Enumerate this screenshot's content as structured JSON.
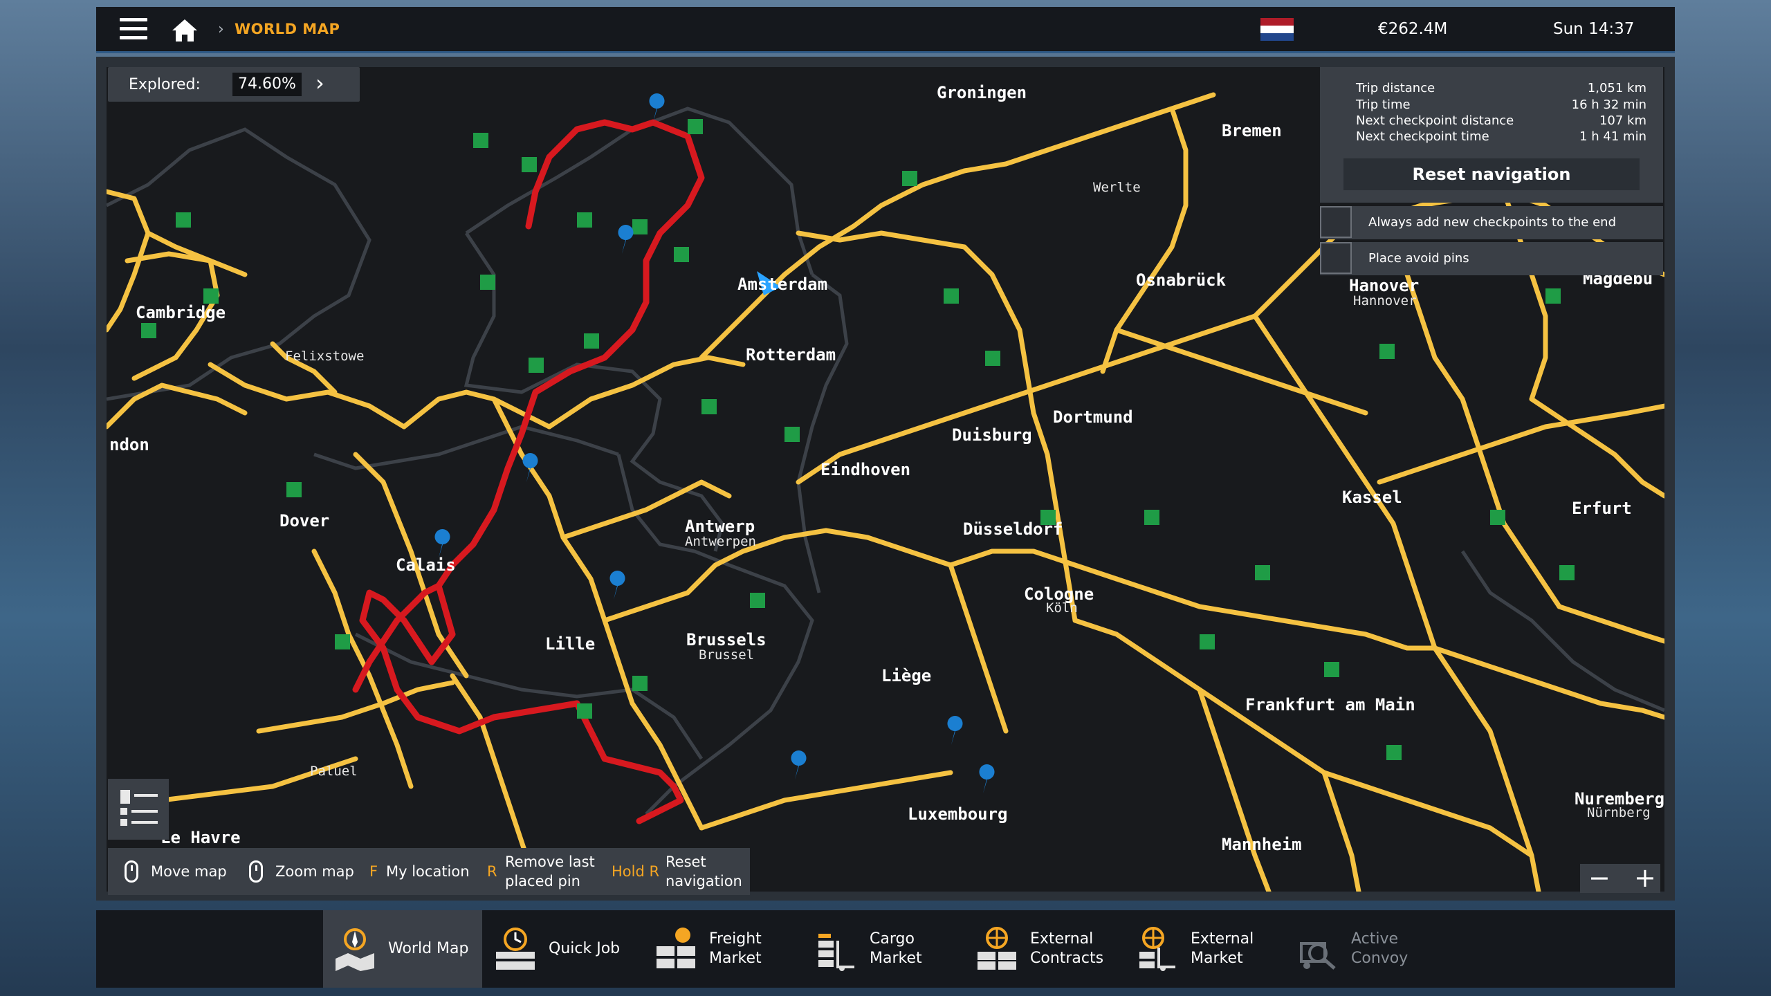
{
  "topbar": {
    "breadcrumb": "WORLD MAP",
    "money": "€262.4M",
    "clock": "Sun 14:37",
    "flag_colors": [
      "#ae1c28",
      "#ffffff",
      "#21468b"
    ]
  },
  "explored": {
    "label": "Explored:",
    "value": "74.60%"
  },
  "navigation": {
    "rows": [
      {
        "key": "Trip distance",
        "value": "1,051 km"
      },
      {
        "key": "Trip time",
        "value": "16 h 32 min"
      },
      {
        "key": "Next checkpoint distance",
        "value": "107 km"
      },
      {
        "key": "Next checkpoint time",
        "value": "1 h 41 min"
      }
    ],
    "reset_label": "Reset navigation",
    "options": [
      "Always add new checkpoints to the end",
      "Place avoid pins"
    ]
  },
  "controls": {
    "move_map": "Move map",
    "zoom_map": "Zoom map",
    "my_location_key": "F",
    "my_location": "My location",
    "remove_key": "R",
    "remove_line1": "Remove last",
    "remove_line2": "placed pin",
    "reset_key": "Hold R",
    "reset_line1": "Reset",
    "reset_line2": "navigation"
  },
  "zoom": {
    "minus": "−",
    "plus": "+"
  },
  "tabs": [
    {
      "line1": "World Map",
      "line2": ""
    },
    {
      "line1": "Quick Job",
      "line2": ""
    },
    {
      "line1": "Freight",
      "line2": "Market"
    },
    {
      "line1": "Cargo",
      "line2": "Market"
    },
    {
      "line1": "External",
      "line2": "Contracts"
    },
    {
      "line1": "External",
      "line2": "Market"
    },
    {
      "line1": "Active",
      "line2": "Convoy"
    }
  ],
  "map": {
    "cities": [
      "Groningen",
      "Bremen",
      "Werlte",
      "Amsterdam",
      "Osnabrück",
      "Hanover",
      "Hannover",
      "Magdebu",
      "Cambridge",
      "Felixstowe",
      "Rotterdam",
      "ndon",
      "Dortmund",
      "Duisburg",
      "Eindhoven",
      "Kassel",
      "Erfurt",
      "Dover",
      "Antwerp",
      "Antwerpen",
      "Düsseldorf",
      "Calais",
      "Cologne",
      "Köln",
      "Lille",
      "Brussels",
      "Brussel",
      "Liège",
      "Frankfurt am Main",
      "Paluel",
      "Luxembourg",
      "Mannheim",
      "Nuremberg",
      "Nürnberg",
      "Le Havre"
    ],
    "waypoints": [
      "1",
      "2",
      "3",
      "4",
      "5",
      "6",
      "7",
      "8"
    ],
    "colors": {
      "road": "#f5c242",
      "route": "#d7191f",
      "land": "#181a1d",
      "border": "#3c4148",
      "service": "#1f9c46",
      "pin": "#1b7fd1"
    }
  }
}
